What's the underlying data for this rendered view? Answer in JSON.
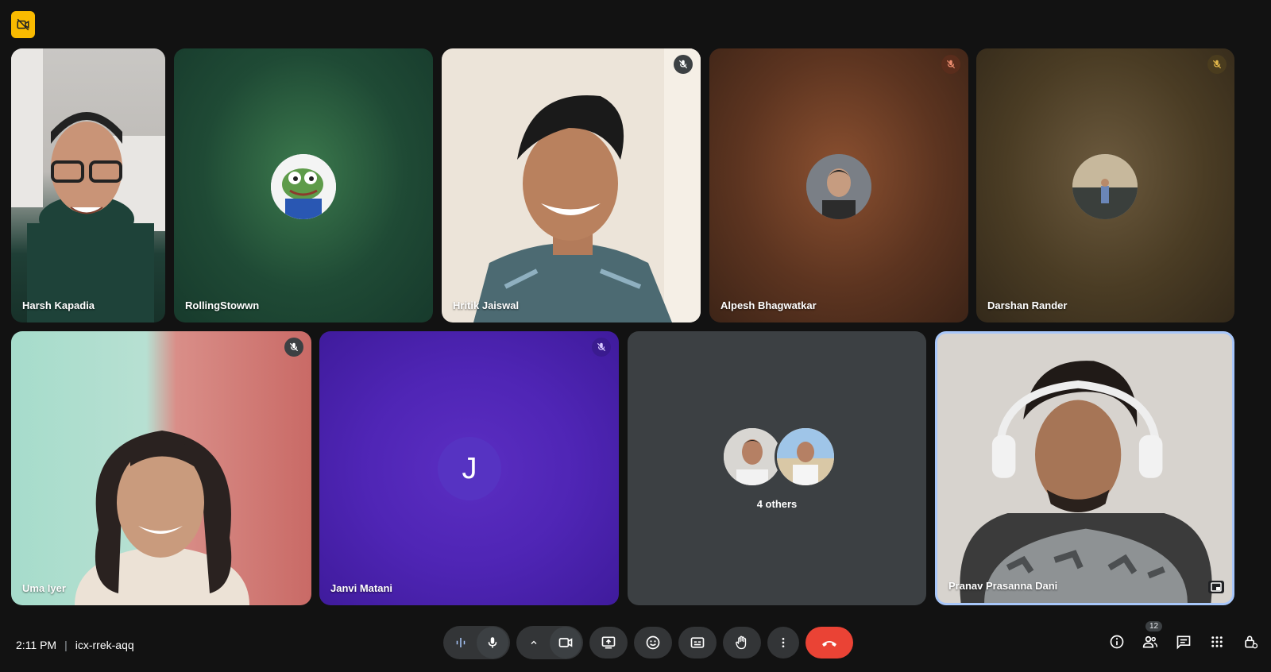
{
  "participants": [
    {
      "name": "Harsh Kapadia",
      "muted": false
    },
    {
      "name": "RollingStowwn",
      "muted": false
    },
    {
      "name": "Hritik Jaiswal",
      "muted": true
    },
    {
      "name": "Alpesh Bhagwatkar",
      "muted": true
    },
    {
      "name": "Darshan Rander",
      "muted": true
    },
    {
      "name": "Uma Iyer",
      "muted": true
    },
    {
      "name": "Janvi Matani",
      "muted": true,
      "initial": "J"
    },
    {
      "name": "Pranav Prasanna Dani",
      "muted": false
    }
  ],
  "others_tile": {
    "label": "4 others"
  },
  "meeting": {
    "time": "2:11 PM",
    "separator": "|",
    "code": "icx-rrek-aqq"
  },
  "people_count": "12",
  "icons": {
    "top_badge": "camera-off-icon",
    "mute": "mic-off-icon",
    "controls": [
      "audio-levels-icon",
      "mic-icon",
      "chevron-up-icon",
      "camera-icon",
      "present-screen-icon",
      "emoji-icon",
      "captions-icon",
      "raise-hand-icon",
      "more-vert-icon",
      "end-call-icon"
    ],
    "right": [
      "info-icon",
      "people-icon",
      "chat-icon",
      "apps-icon",
      "lock-icon"
    ]
  },
  "colors": {
    "background": "#121212",
    "end_call": "#ea4335",
    "badge": "#f9ba00",
    "active_speaker_border": "#a8c7fa"
  }
}
